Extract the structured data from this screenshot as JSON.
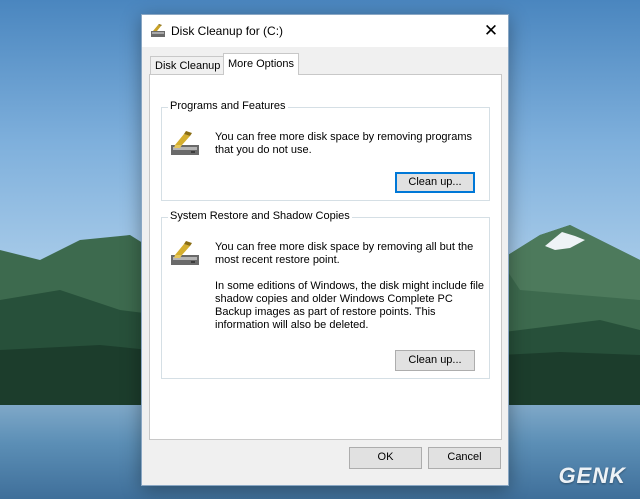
{
  "window": {
    "title": "Disk Cleanup for  (C:)",
    "close_symbol": "✕"
  },
  "tabs": [
    {
      "label": "Disk Cleanup",
      "active": false
    },
    {
      "label": "More Options",
      "active": true
    }
  ],
  "programs": {
    "title": "Programs and Features",
    "description": "You can free more disk space by removing programs that you do not use.",
    "button_label": "Clean up..."
  },
  "restore": {
    "title": "System Restore and Shadow Copies",
    "description": "You can free more disk space by removing all but the most recent restore point.",
    "note": "In some editions of Windows, the disk might include file shadow copies and older Windows Complete PC Backup images as part of restore points. This information will also be deleted.",
    "button_label": "Clean up..."
  },
  "footer": {
    "ok_label": "OK",
    "cancel_label": "Cancel"
  },
  "watermark": "GENK",
  "icons": {
    "title": "disk-cleanup-icon",
    "programs": "disk-cleanup-icon",
    "restore": "disk-cleanup-icon"
  },
  "colors": {
    "focus_border": "#0078d7",
    "button_face": "#e1e1e1"
  }
}
